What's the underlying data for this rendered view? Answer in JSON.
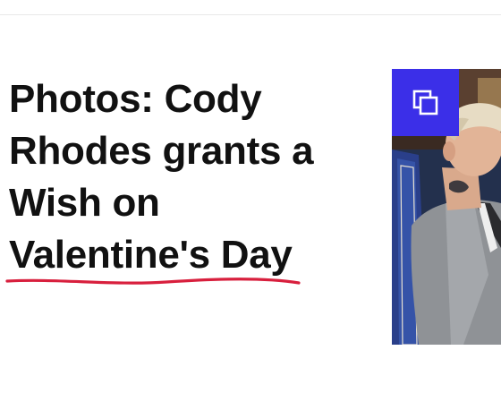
{
  "article": {
    "headline_lines": [
      "Photos: Cody",
      "Rhodes grants a",
      "Wish on",
      "Valentine's Day"
    ]
  },
  "gallery_badge": {
    "icon": "gallery-icon"
  },
  "thumbnail": {
    "alt": "Cody Rhodes"
  },
  "colors": {
    "headline": "#111111",
    "underline_accent": "#d81f3d",
    "badge_background": "#3b2fe8",
    "divider": "#e8e8e8"
  }
}
